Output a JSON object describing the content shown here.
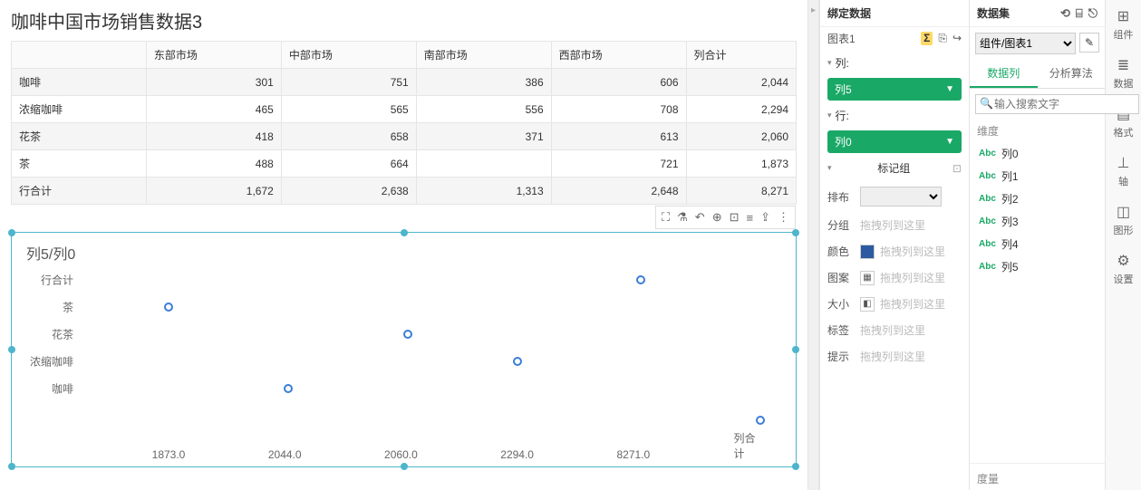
{
  "title": "咖啡中国市场销售数据3",
  "table": {
    "headers": [
      "",
      "东部市场",
      "中部市场",
      "南部市场",
      "西部市场",
      "列合计"
    ],
    "rows": [
      {
        "label": "咖啡",
        "values": [
          "301",
          "751",
          "386",
          "606",
          "2,044"
        ]
      },
      {
        "label": "浓缩咖啡",
        "values": [
          "465",
          "565",
          "556",
          "708",
          "2,294"
        ]
      },
      {
        "label": "花茶",
        "values": [
          "418",
          "658",
          "371",
          "613",
          "2,060"
        ]
      },
      {
        "label": "茶",
        "values": [
          "488",
          "664",
          "",
          "721",
          "1,873"
        ]
      },
      {
        "label": "行合计",
        "values": [
          "1,672",
          "2,638",
          "1,313",
          "2,648",
          "8,271"
        ]
      }
    ]
  },
  "chart_toolbar": [
    "⛶",
    "⚗",
    "↶",
    "⊕",
    "⊡",
    "≡",
    "⇪",
    "⋮"
  ],
  "chart_data": {
    "type": "scatter",
    "title": "列5/列0",
    "y_categories": [
      "行合计",
      "茶",
      "花茶",
      "浓缩咖啡",
      "咖啡"
    ],
    "x_labels": [
      "1873.0",
      "2044.0",
      "2060.0",
      "2294.0",
      "8271.0",
      "列合计"
    ],
    "points": [
      {
        "y": "茶",
        "x_pct": 13
      },
      {
        "y": "行合计",
        "x_pct": 80
      },
      {
        "y": "花茶",
        "x_pct": 47
      },
      {
        "y": "浓缩咖啡",
        "x_pct": 62.5
      },
      {
        "y": "咖啡",
        "x_pct": 30
      },
      {
        "y_offset_extra": true,
        "x_pct": 97
      }
    ]
  },
  "bind_panel": {
    "title": "绑定数据",
    "chart_name": "图表1",
    "col_label": "列:",
    "col_pill": "列5",
    "row_label": "行:",
    "row_pill": "列0",
    "mark_group": "标记组",
    "layout_label": "排布",
    "group_label": "分组",
    "color_label": "颜色",
    "pattern_label": "图案",
    "size_label": "大小",
    "label_label": "标签",
    "tip_label": "提示",
    "drag_placeholder": "拖拽列到这里"
  },
  "data_panel": {
    "title": "数据集",
    "select_value": "组件/图表1",
    "tab_cols": "数据列",
    "tab_calc": "分析算法",
    "search_placeholder": "输入搜索文字",
    "dimension_label": "维度",
    "columns": [
      "列0",
      "列1",
      "列2",
      "列3",
      "列4",
      "列5"
    ],
    "measure_label": "度量"
  },
  "side_tabs": [
    {
      "icon": "⊞",
      "label": "组件"
    },
    {
      "icon": "≣",
      "label": "数据"
    },
    {
      "icon": "▤",
      "label": "格式"
    },
    {
      "icon": "⊥",
      "label": "轴"
    },
    {
      "icon": "◫",
      "label": "图形"
    },
    {
      "icon": "⚙",
      "label": "设置"
    }
  ]
}
